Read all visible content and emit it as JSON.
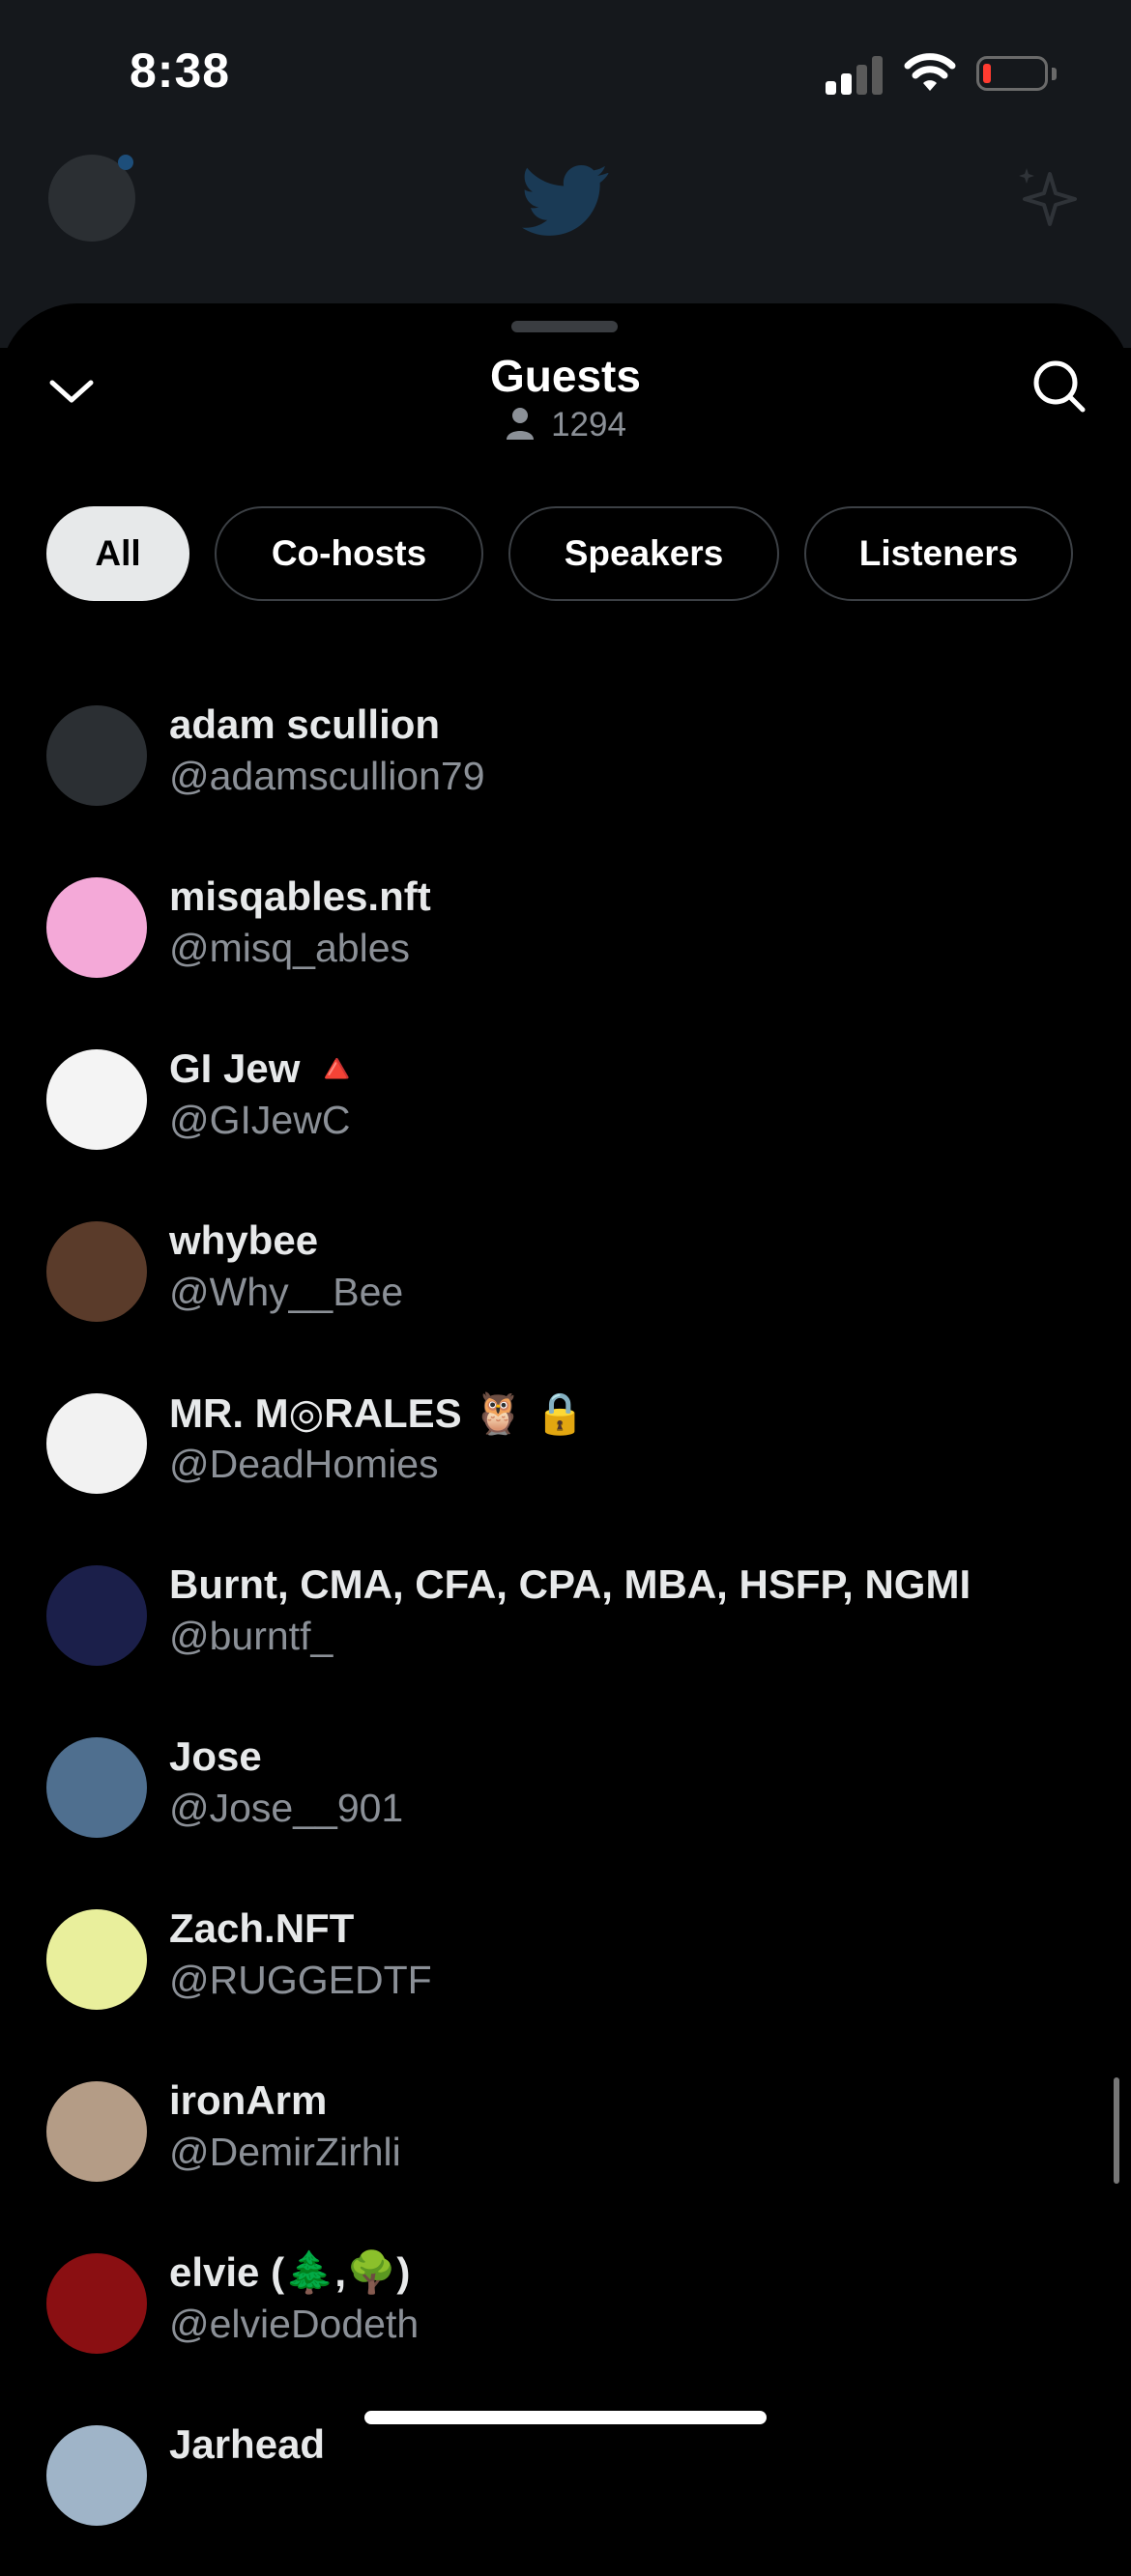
{
  "status_bar": {
    "time": "8:38"
  },
  "sheet": {
    "title": "Guests",
    "listener_count": "1294",
    "tabs": [
      {
        "label": "All",
        "active": true
      },
      {
        "label": "Co-hosts",
        "active": false
      },
      {
        "label": "Speakers",
        "active": false
      },
      {
        "label": "Listeners",
        "active": false
      }
    ]
  },
  "guests": [
    {
      "name": "adam scullion",
      "handle": "@adamscullion79",
      "avatar_color": "#2b2f33"
    },
    {
      "name": "misqables.nft",
      "handle": "@misq_ables",
      "avatar_color": "#f4a9d8"
    },
    {
      "name": "GI Jew 🔺",
      "handle": "@GIJewC",
      "avatar_color": "#f4f4f4"
    },
    {
      "name": "whybee",
      "handle": "@Why__Bee",
      "avatar_color": "#5a3b2a"
    },
    {
      "name": "MR. M◎RALES 🦉 🔒",
      "handle": "@DeadHomies",
      "avatar_color": "#f2f2f2"
    },
    {
      "name": "Burnt, CMA, CFA, CPA, MBA, HSFP, NGMI",
      "handle": "@burntf_",
      "avatar_color": "#1b1f4a"
    },
    {
      "name": "Jose",
      "handle": "@Jose__901",
      "avatar_color": "#4f6f8f"
    },
    {
      "name": "Zach.NFT",
      "handle": "@RUGGEDTF",
      "avatar_color": "#e9ef9c"
    },
    {
      "name": "ironArm",
      "handle": "@DemirZirhli",
      "avatar_color": "#b49c86"
    },
    {
      "name": "elvie (🌲,🌳)",
      "handle": "@elvieDodeth",
      "avatar_color": "#8a0f12"
    },
    {
      "name": "Jarhead",
      "handle": "",
      "avatar_color": "#9fb4c8"
    }
  ]
}
